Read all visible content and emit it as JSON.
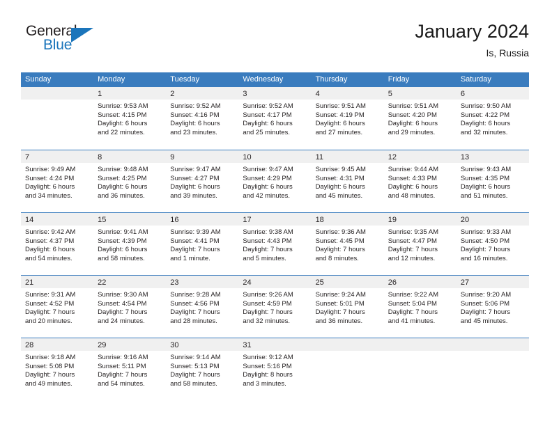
{
  "brand": {
    "name_part1": "General",
    "name_part2": "Blue",
    "logo_icon": "triangle-flag-icon"
  },
  "header": {
    "title": "January 2024",
    "location": "Is, Russia"
  },
  "calendar": {
    "weekday_headers": [
      "Sunday",
      "Monday",
      "Tuesday",
      "Wednesday",
      "Thursday",
      "Friday",
      "Saturday"
    ],
    "accent_color": "#3a7cbe",
    "day_strip_color": "#f0f0f0",
    "weeks": [
      [
        {
          "day": "",
          "lines": []
        },
        {
          "day": "1",
          "lines": [
            "Sunrise: 9:53 AM",
            "Sunset: 4:15 PM",
            "Daylight: 6 hours",
            "and 22 minutes."
          ]
        },
        {
          "day": "2",
          "lines": [
            "Sunrise: 9:52 AM",
            "Sunset: 4:16 PM",
            "Daylight: 6 hours",
            "and 23 minutes."
          ]
        },
        {
          "day": "3",
          "lines": [
            "Sunrise: 9:52 AM",
            "Sunset: 4:17 PM",
            "Daylight: 6 hours",
            "and 25 minutes."
          ]
        },
        {
          "day": "4",
          "lines": [
            "Sunrise: 9:51 AM",
            "Sunset: 4:19 PM",
            "Daylight: 6 hours",
            "and 27 minutes."
          ]
        },
        {
          "day": "5",
          "lines": [
            "Sunrise: 9:51 AM",
            "Sunset: 4:20 PM",
            "Daylight: 6 hours",
            "and 29 minutes."
          ]
        },
        {
          "day": "6",
          "lines": [
            "Sunrise: 9:50 AM",
            "Sunset: 4:22 PM",
            "Daylight: 6 hours",
            "and 32 minutes."
          ]
        }
      ],
      [
        {
          "day": "7",
          "lines": [
            "Sunrise: 9:49 AM",
            "Sunset: 4:24 PM",
            "Daylight: 6 hours",
            "and 34 minutes."
          ]
        },
        {
          "day": "8",
          "lines": [
            "Sunrise: 9:48 AM",
            "Sunset: 4:25 PM",
            "Daylight: 6 hours",
            "and 36 minutes."
          ]
        },
        {
          "day": "9",
          "lines": [
            "Sunrise: 9:47 AM",
            "Sunset: 4:27 PM",
            "Daylight: 6 hours",
            "and 39 minutes."
          ]
        },
        {
          "day": "10",
          "lines": [
            "Sunrise: 9:47 AM",
            "Sunset: 4:29 PM",
            "Daylight: 6 hours",
            "and 42 minutes."
          ]
        },
        {
          "day": "11",
          "lines": [
            "Sunrise: 9:45 AM",
            "Sunset: 4:31 PM",
            "Daylight: 6 hours",
            "and 45 minutes."
          ]
        },
        {
          "day": "12",
          "lines": [
            "Sunrise: 9:44 AM",
            "Sunset: 4:33 PM",
            "Daylight: 6 hours",
            "and 48 minutes."
          ]
        },
        {
          "day": "13",
          "lines": [
            "Sunrise: 9:43 AM",
            "Sunset: 4:35 PM",
            "Daylight: 6 hours",
            "and 51 minutes."
          ]
        }
      ],
      [
        {
          "day": "14",
          "lines": [
            "Sunrise: 9:42 AM",
            "Sunset: 4:37 PM",
            "Daylight: 6 hours",
            "and 54 minutes."
          ]
        },
        {
          "day": "15",
          "lines": [
            "Sunrise: 9:41 AM",
            "Sunset: 4:39 PM",
            "Daylight: 6 hours",
            "and 58 minutes."
          ]
        },
        {
          "day": "16",
          "lines": [
            "Sunrise: 9:39 AM",
            "Sunset: 4:41 PM",
            "Daylight: 7 hours",
            "and 1 minute."
          ]
        },
        {
          "day": "17",
          "lines": [
            "Sunrise: 9:38 AM",
            "Sunset: 4:43 PM",
            "Daylight: 7 hours",
            "and 5 minutes."
          ]
        },
        {
          "day": "18",
          "lines": [
            "Sunrise: 9:36 AM",
            "Sunset: 4:45 PM",
            "Daylight: 7 hours",
            "and 8 minutes."
          ]
        },
        {
          "day": "19",
          "lines": [
            "Sunrise: 9:35 AM",
            "Sunset: 4:47 PM",
            "Daylight: 7 hours",
            "and 12 minutes."
          ]
        },
        {
          "day": "20",
          "lines": [
            "Sunrise: 9:33 AM",
            "Sunset: 4:50 PM",
            "Daylight: 7 hours",
            "and 16 minutes."
          ]
        }
      ],
      [
        {
          "day": "21",
          "lines": [
            "Sunrise: 9:31 AM",
            "Sunset: 4:52 PM",
            "Daylight: 7 hours",
            "and 20 minutes."
          ]
        },
        {
          "day": "22",
          "lines": [
            "Sunrise: 9:30 AM",
            "Sunset: 4:54 PM",
            "Daylight: 7 hours",
            "and 24 minutes."
          ]
        },
        {
          "day": "23",
          "lines": [
            "Sunrise: 9:28 AM",
            "Sunset: 4:56 PM",
            "Daylight: 7 hours",
            "and 28 minutes."
          ]
        },
        {
          "day": "24",
          "lines": [
            "Sunrise: 9:26 AM",
            "Sunset: 4:59 PM",
            "Daylight: 7 hours",
            "and 32 minutes."
          ]
        },
        {
          "day": "25",
          "lines": [
            "Sunrise: 9:24 AM",
            "Sunset: 5:01 PM",
            "Daylight: 7 hours",
            "and 36 minutes."
          ]
        },
        {
          "day": "26",
          "lines": [
            "Sunrise: 9:22 AM",
            "Sunset: 5:04 PM",
            "Daylight: 7 hours",
            "and 41 minutes."
          ]
        },
        {
          "day": "27",
          "lines": [
            "Sunrise: 9:20 AM",
            "Sunset: 5:06 PM",
            "Daylight: 7 hours",
            "and 45 minutes."
          ]
        }
      ],
      [
        {
          "day": "28",
          "lines": [
            "Sunrise: 9:18 AM",
            "Sunset: 5:08 PM",
            "Daylight: 7 hours",
            "and 49 minutes."
          ]
        },
        {
          "day": "29",
          "lines": [
            "Sunrise: 9:16 AM",
            "Sunset: 5:11 PM",
            "Daylight: 7 hours",
            "and 54 minutes."
          ]
        },
        {
          "day": "30",
          "lines": [
            "Sunrise: 9:14 AM",
            "Sunset: 5:13 PM",
            "Daylight: 7 hours",
            "and 58 minutes."
          ]
        },
        {
          "day": "31",
          "lines": [
            "Sunrise: 9:12 AM",
            "Sunset: 5:16 PM",
            "Daylight: 8 hours",
            "and 3 minutes."
          ]
        },
        {
          "day": "",
          "lines": []
        },
        {
          "day": "",
          "lines": []
        },
        {
          "day": "",
          "lines": []
        }
      ]
    ]
  }
}
